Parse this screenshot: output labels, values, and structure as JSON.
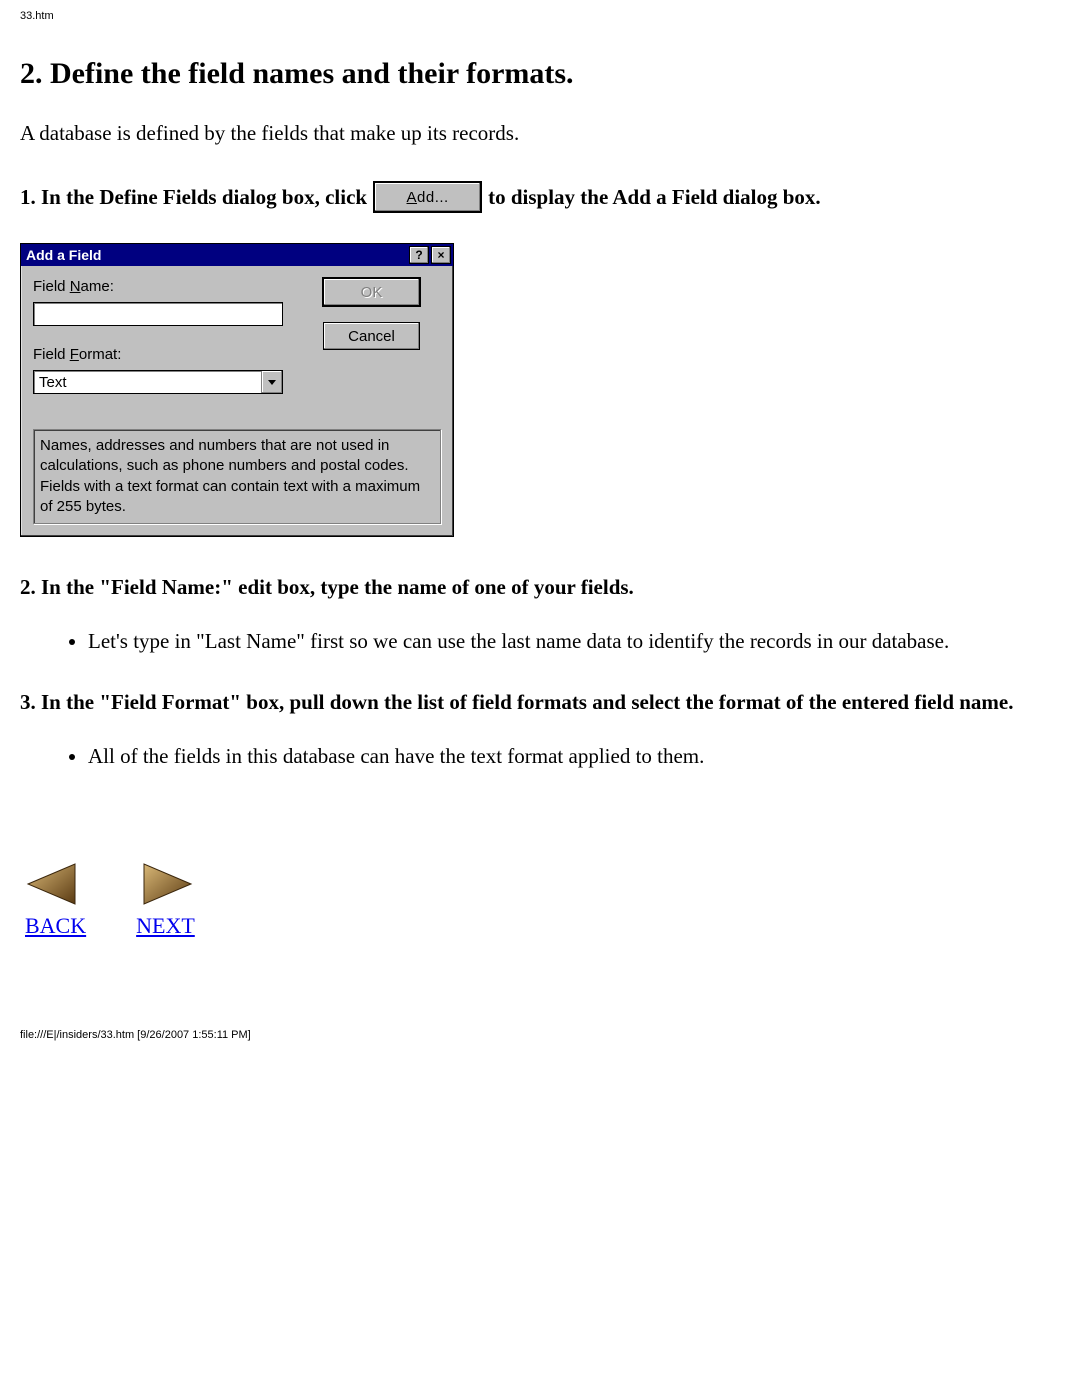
{
  "header_filename": "33.htm",
  "page_title": "2. Define the field names and their formats.",
  "intro": "A database is defined by the fields that make up its records.",
  "step1": {
    "before": "1. In the Define Fields dialog box, click",
    "button_label": "Add...",
    "button_hotkey": "A",
    "after": "to display the Add a Field dialog box."
  },
  "dialog": {
    "title": "Add a Field",
    "help_icon": "?",
    "close_icon": "×",
    "field_name_label": "Field Name:",
    "field_name_hotkey": "N",
    "field_name_value": "",
    "field_format_label": "Field Format:",
    "field_format_hotkey": "F",
    "field_format_value": "Text",
    "ok_label": "OK",
    "cancel_label": "Cancel",
    "description": "Names, addresses and numbers that are not used in calculations, such as phone numbers and postal codes.\nFields with a text format can contain text with a maximum of 255 bytes."
  },
  "step2": "2. In the \"Field Name:\" edit box, type the name of one of your fields.",
  "bullet2": "Let's type in \"Last Name\" first so we can use the last name data to identify the records in our database.",
  "step3": "3. In the \"Field Format\" box, pull down the list of field formats and select the format of the entered field name.",
  "bullet3": "All of the fields in this database can have the text format applied to them.",
  "nav": {
    "back": "BACK",
    "next": "NEXT"
  },
  "footer_path": "file:///E|/insiders/33.htm [9/26/2007 1:55:11 PM]"
}
